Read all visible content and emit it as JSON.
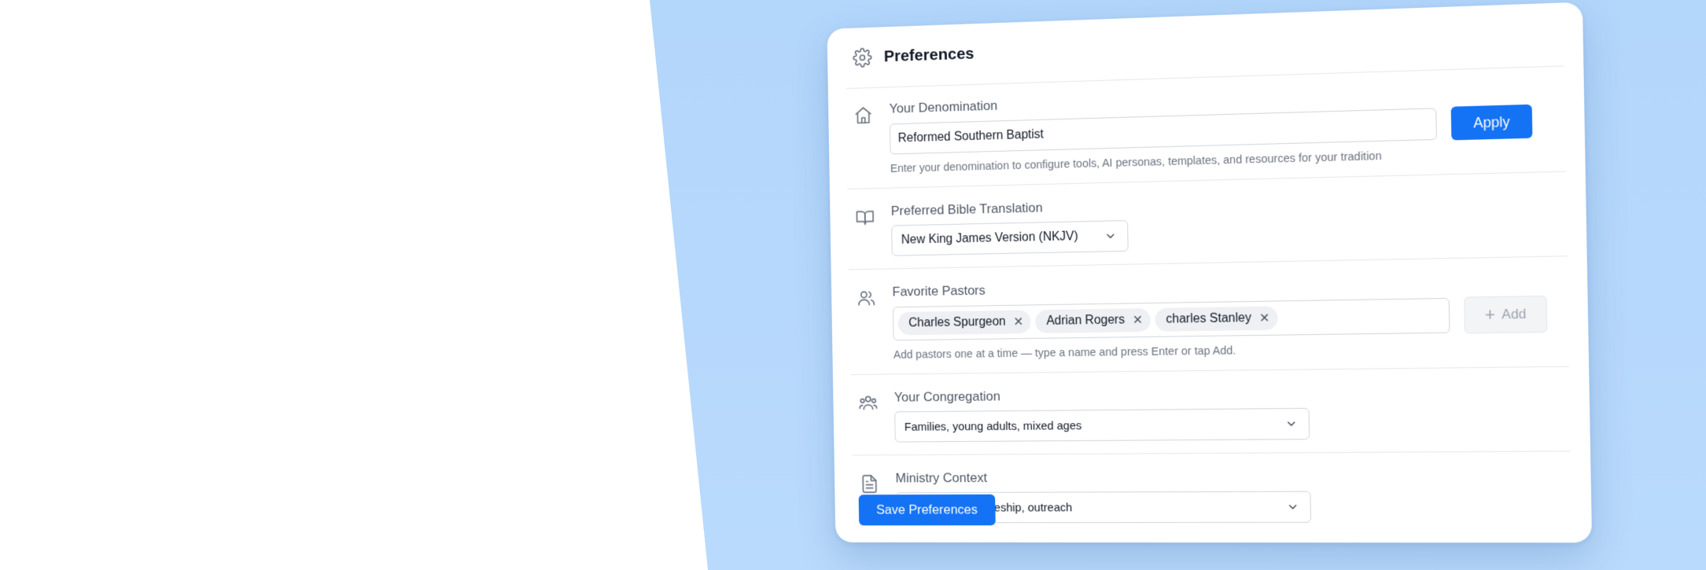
{
  "header": {
    "title": "Preferences",
    "icon": "gear-icon"
  },
  "denomination": {
    "label": "Your Denomination",
    "value": "Reformed Southern Baptist",
    "apply_label": "Apply",
    "help": "Enter your denomination to configure tools, AI personas, templates, and resources for your tradition",
    "icon": "home-icon"
  },
  "bible_translation": {
    "label": "Preferred Bible Translation",
    "selected": "New King James Version (NKJV)",
    "icon": "book-icon"
  },
  "pastors": {
    "label": "Favorite Pastors",
    "chips": [
      "Charles Spurgeon",
      "Adrian Rogers",
      "charles Stanley"
    ],
    "add_label": "Add",
    "help": "Add pastors one at a time — type a name and press Enter or tap Add.",
    "icon": "users-icon"
  },
  "congregation": {
    "label": "Your Congregation",
    "selected": "Families, young adults, mixed ages",
    "icon": "group-icon"
  },
  "ministry": {
    "label": "Ministry Context",
    "selected": "Preaching, discipleship, outreach",
    "icon": "document-icon"
  },
  "footer": {
    "save_label": "Save Preferences"
  },
  "colors": {
    "accent": "#1472f5",
    "background": "#b3d6fb"
  }
}
